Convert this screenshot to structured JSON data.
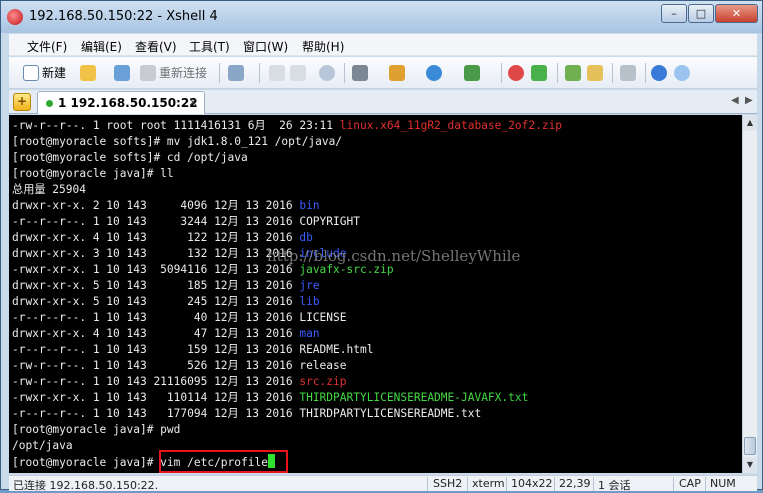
{
  "window": {
    "title": "192.168.50.150:22 - Xshell 4",
    "min": "–",
    "max": "□",
    "close": "✕"
  },
  "menu": [
    "文件(F)",
    "编辑(E)",
    "查看(V)",
    "工具(T)",
    "窗口(W)",
    "帮助(H)"
  ],
  "toolbar": {
    "new_label": "新建",
    "reconnect_label": "重新连接"
  },
  "tab": {
    "label": "1 192.168.50.150:22",
    "close": "×",
    "add": "+",
    "scroll_left": "◀",
    "scroll_right": "▶"
  },
  "terminal": {
    "lines": [
      [
        {
          "t": "-rw-r--r--. 1 root root 1111416131 6月  26 23:11 ",
          "c": "white"
        },
        {
          "t": "linux.x64_11gR2_database_2of2.zip",
          "c": "red"
        }
      ],
      [
        {
          "t": "[root@myoracle softs]# mv jdk1.8.0_121 /opt/java/",
          "c": "white"
        }
      ],
      [
        {
          "t": "[root@myoracle softs]# cd /opt/java",
          "c": "white"
        }
      ],
      [
        {
          "t": "[root@myoracle java]# ll",
          "c": "white"
        }
      ],
      [
        {
          "t": "总用量 25904",
          "c": "white"
        }
      ],
      [
        {
          "t": "drwxr-xr-x. 2 10 143     4096 12月 13 2016 ",
          "c": "white"
        },
        {
          "t": "bin",
          "c": "blue"
        }
      ],
      [
        {
          "t": "-r--r--r--. 1 10 143     3244 12月 13 2016 COPYRIGHT",
          "c": "white"
        }
      ],
      [
        {
          "t": "drwxr-xr-x. 4 10 143      122 12月 13 2016 ",
          "c": "white"
        },
        {
          "t": "db",
          "c": "blue"
        }
      ],
      [
        {
          "t": "drwxr-xr-x. 3 10 143      132 12月 13 2016 ",
          "c": "white"
        },
        {
          "t": "include",
          "c": "blue"
        }
      ],
      [
        {
          "t": "-rwxr-xr-x. 1 10 143  5094116 12月 13 2016 ",
          "c": "white"
        },
        {
          "t": "javafx-src.zip",
          "c": "green"
        }
      ],
      [
        {
          "t": "drwxr-xr-x. 5 10 143      185 12月 13 2016 ",
          "c": "white"
        },
        {
          "t": "jre",
          "c": "blue"
        }
      ],
      [
        {
          "t": "drwxr-xr-x. 5 10 143      245 12月 13 2016 ",
          "c": "white"
        },
        {
          "t": "lib",
          "c": "blue"
        }
      ],
      [
        {
          "t": "-r--r--r--. 1 10 143       40 12月 13 2016 LICENSE",
          "c": "white"
        }
      ],
      [
        {
          "t": "drwxr-xr-x. 4 10 143       47 12月 13 2016 ",
          "c": "white"
        },
        {
          "t": "man",
          "c": "blue"
        }
      ],
      [
        {
          "t": "-r--r--r--. 1 10 143      159 12月 13 2016 README.html",
          "c": "white"
        }
      ],
      [
        {
          "t": "-rw-r--r--. 1 10 143      526 12月 13 2016 release",
          "c": "white"
        }
      ],
      [
        {
          "t": "-rw-r--r--. 1 10 143 21116095 12月 13 2016 ",
          "c": "white"
        },
        {
          "t": "src.zip",
          "c": "red"
        }
      ],
      [
        {
          "t": "-rwxr-xr-x. 1 10 143   110114 12月 13 2016 ",
          "c": "white"
        },
        {
          "t": "THIRDPARTYLICENSEREADME-JAVAFX.txt",
          "c": "green"
        }
      ],
      [
        {
          "t": "-r--r--r--. 1 10 143   177094 12月 13 2016 THIRDPARTYLICENSEREADME.txt",
          "c": "white"
        }
      ],
      [
        {
          "t": "[root@myoracle java]# pwd",
          "c": "white"
        }
      ],
      [
        {
          "t": "/opt/java",
          "c": "white"
        }
      ],
      [
        {
          "t": "[root@myoracle java]# vim /etc/profile",
          "c": "white"
        }
      ]
    ],
    "watermark": "http://blog.csdn.net/ShelleyWhile"
  },
  "status": {
    "connection": "已连接 192.168.50.150:22.",
    "protocol": "SSH2",
    "term": "xterm",
    "size": "104x22",
    "cursor_pos": "22,39",
    "sessions": "1 会话",
    "caps": "CAP",
    "num": "NUM"
  },
  "colors": {
    "red": "#e03030",
    "blue": "#3a5cff",
    "green": "#42d842",
    "highlight": "#e8141a"
  }
}
